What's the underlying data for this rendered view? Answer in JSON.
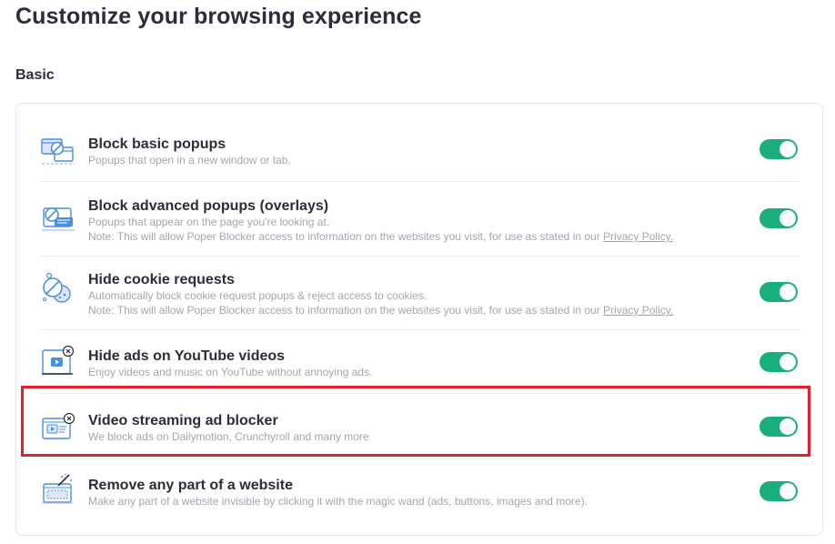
{
  "page": {
    "title": "Customize your browsing experience"
  },
  "section": {
    "title": "Basic"
  },
  "settings": [
    {
      "title": "Block basic popups",
      "description": "Popups that open in a new window or tab.",
      "enabled": true,
      "icon": "popup-window-icon"
    },
    {
      "title": "Block advanced popups (overlays)",
      "description": "Popups that appear on the page you're looking at.",
      "note_prefix": "Note: This will allow Poper Blocker access to information on the websites you visit, for use as stated in our ",
      "note_link": "Privacy Policy.",
      "enabled": true,
      "icon": "overlay-popup-icon"
    },
    {
      "title": "Hide cookie requests",
      "description": "Automatically block cookie request popups & reject access to cookies.",
      "note_prefix": "Note: This will allow Poper Blocker access to information on the websites you visit, for use as stated in our ",
      "note_link": "Privacy Policy.",
      "enabled": true,
      "icon": "cookie-block-icon"
    },
    {
      "title": "Hide ads on YouTube videos",
      "description": "Enjoy videos and music on YouTube without annoying ads.",
      "enabled": true,
      "icon": "youtube-ad-block-icon"
    },
    {
      "title": "Video streaming ad blocker",
      "description": "We block ads on Dailymotion, Crunchyroll and many more",
      "enabled": true,
      "icon": "video-streaming-icon"
    },
    {
      "title": "Remove any part of a website",
      "description": "Make any part of a website invisible by clicking it with the magic wand (ads, buttons, images and more).",
      "enabled": true,
      "icon": "magic-wand-icon"
    }
  ],
  "colors": {
    "toggle_on": "#1aae7e",
    "highlight": "#e0222a",
    "icon_blue": "#4a8fe0"
  }
}
